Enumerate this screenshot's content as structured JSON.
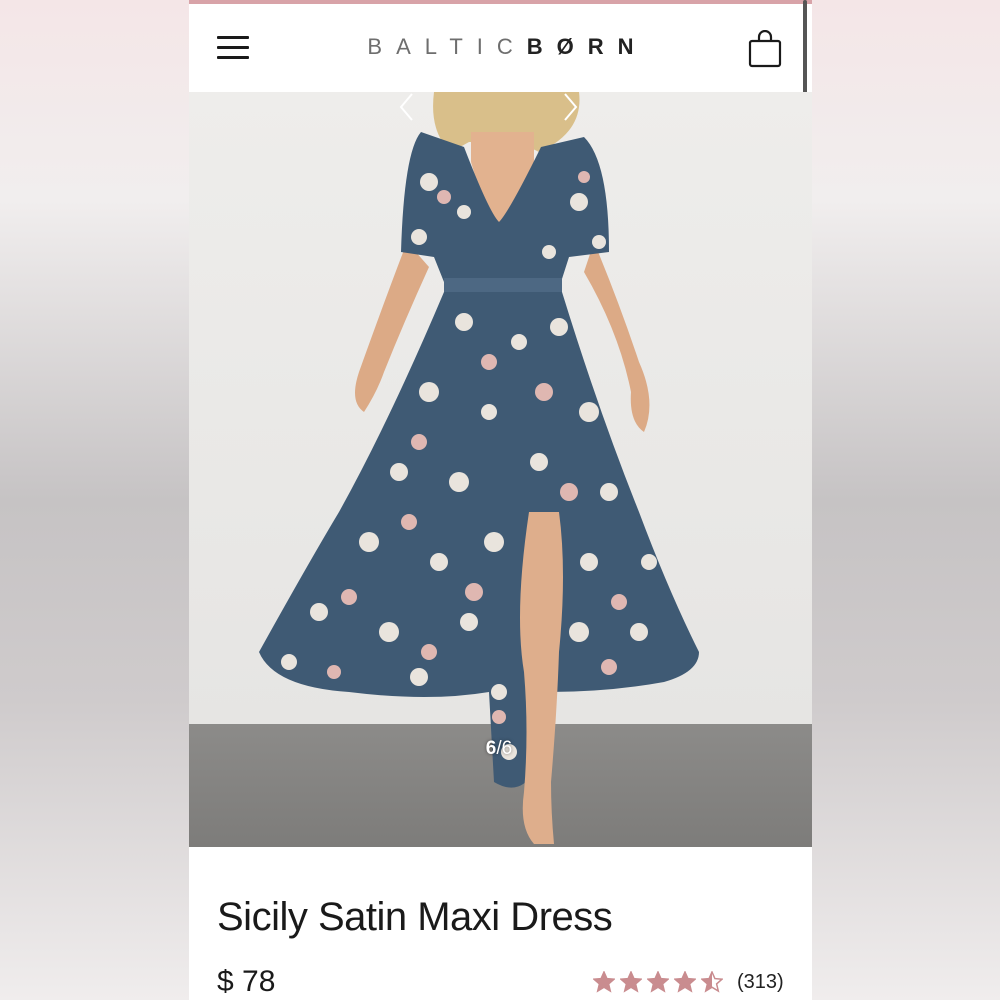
{
  "header": {
    "logo_part1": "BALTIC",
    "logo_part2": "BØRN",
    "menu_icon": "hamburger-icon",
    "bag_icon": "shopping-bag-icon"
  },
  "gallery": {
    "current": "6",
    "separator": "/",
    "total": "6",
    "prev_icon": "chevron-left-icon",
    "next_icon": "chevron-right-icon"
  },
  "product": {
    "title": "Sicily Satin Maxi Dress",
    "price": "$ 78",
    "rating": 4.5,
    "rating_max": 5,
    "review_count": "(313)",
    "star_color": "#c98c8f"
  },
  "colors": {
    "accent_strip": "#d8a3a8",
    "dress_blue": "#3f5a74"
  }
}
